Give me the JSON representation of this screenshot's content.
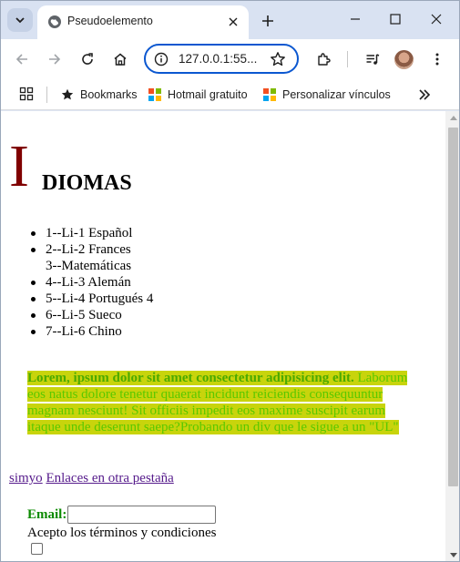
{
  "browser": {
    "tab_title": "Pseudoelemento",
    "url": "127.0.0.1:55...",
    "bookmarks": [
      {
        "label": "Bookmarks",
        "icon": "star-icon"
      },
      {
        "label": "Hotmail gratuito",
        "icon": "microsoft-icon"
      },
      {
        "label": "Personalizar vínculos",
        "icon": "microsoft-icon"
      }
    ]
  },
  "page": {
    "heading_cap": "I",
    "heading_rest": "DIOMAS",
    "languages": [
      {
        "text": "1--Li-1 Español",
        "bullet": true
      },
      {
        "text": "2--Li-2 Frances",
        "bullet": true
      },
      {
        "text": "3--Matemáticas",
        "bullet": false
      },
      {
        "text": "4--Li-3 Alemán",
        "bullet": true
      },
      {
        "text": "5--Li-4 Portugués 4",
        "bullet": true
      },
      {
        "text": "6--Li-5 Sueco",
        "bullet": true
      },
      {
        "text": "7--Li-6 Chino",
        "bullet": true
      }
    ],
    "lorem_bold": "Lorem, ipsum dolor sit amet consectetur adipisicing elit.",
    "lorem_body": "Laborum eos natus dolore tenetur quaerat incidunt reiciendis consequuntur magnam nesciunt! Sit officiis impedit eos maxime suscipit earum itaque unde deserunt saepe?Probando un div que le sigue a un \"UL\"",
    "link_1": "simyo",
    "link_2": "Enlaces en otra pestaña",
    "email_label": "Email:",
    "email_value": "",
    "terms_label": "Acepto los términos y condiciones"
  },
  "colors": {
    "drop_cap": "#800000",
    "lorem_text": "#5ac800",
    "lorem_highlight": "#c8d40c",
    "email_label": "#0b8a00",
    "accent": "#0b57d0"
  }
}
